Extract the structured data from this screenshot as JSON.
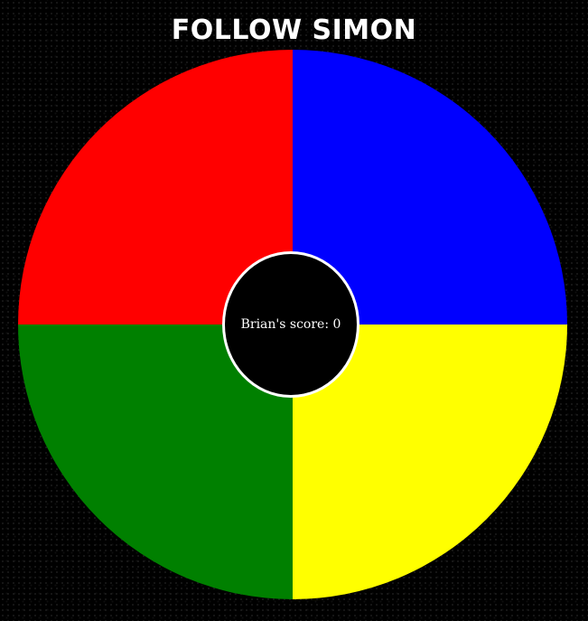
{
  "title": "FOLLOW SIMON",
  "board": {
    "pads": [
      {
        "position": "top-left",
        "color": "#ff0000"
      },
      {
        "position": "top-right",
        "color": "#0000ff"
      },
      {
        "position": "bottom-left",
        "color": "#008000"
      },
      {
        "position": "bottom-right",
        "color": "#ffff00"
      }
    ],
    "score_text": "Brian's score: 0"
  }
}
